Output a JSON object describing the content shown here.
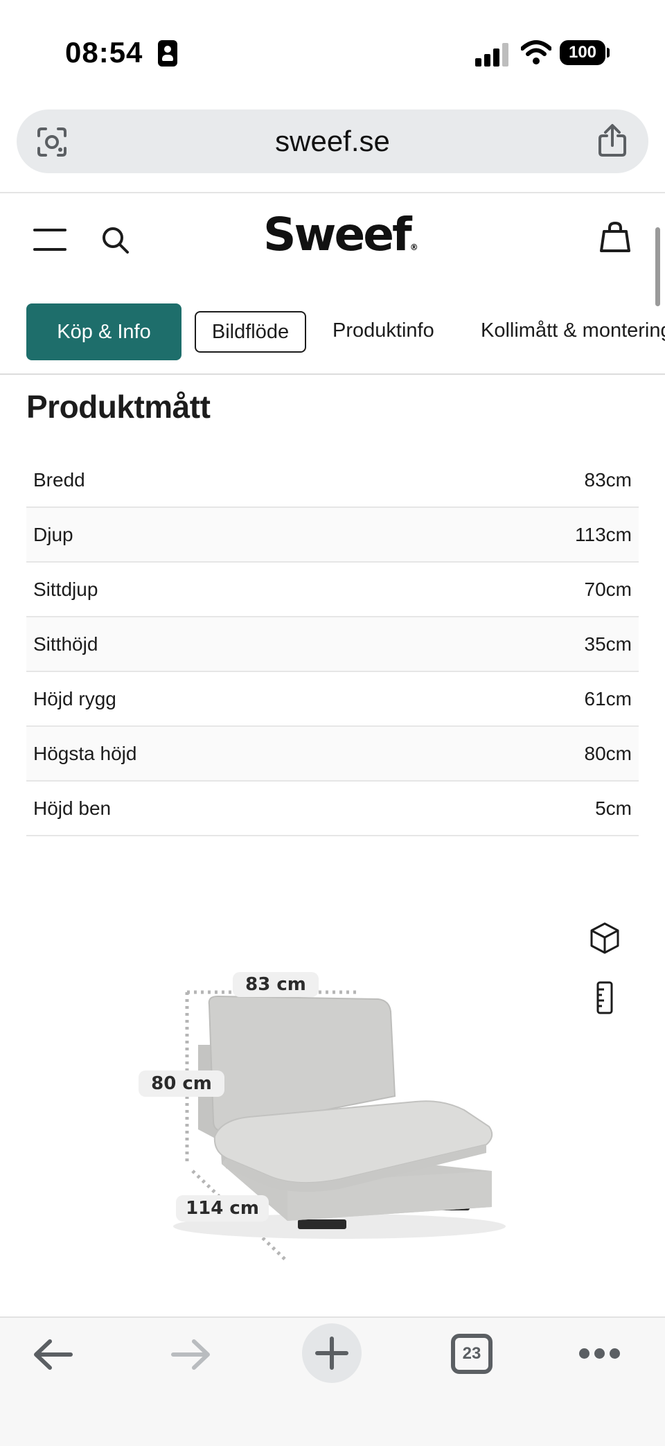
{
  "status_bar": {
    "time": "08:54",
    "battery": "100"
  },
  "browser": {
    "url": "sweef.se",
    "tabs_count": "23"
  },
  "site": {
    "logo": "Sweef",
    "logo_mark": "®"
  },
  "tabs": [
    {
      "label": "Köp & Info",
      "state": "active"
    },
    {
      "label": "Bildflöde",
      "state": "outlined"
    },
    {
      "label": "Produktinfo",
      "state": "normal"
    },
    {
      "label": "Kollimått & montering",
      "state": "normal"
    }
  ],
  "section": {
    "title": "Produktmått"
  },
  "measurements": [
    {
      "label": "Bredd",
      "value": "83cm"
    },
    {
      "label": "Djup",
      "value": "113cm"
    },
    {
      "label": "Sittdjup",
      "value": "70cm"
    },
    {
      "label": "Sitthöjd",
      "value": "35cm"
    },
    {
      "label": "Höjd rygg",
      "value": "61cm"
    },
    {
      "label": "Högsta höjd",
      "value": "80cm"
    },
    {
      "label": "Höjd ben",
      "value": "5cm"
    }
  ],
  "illustration": {
    "width_label": "83 cm",
    "height_label": "80 cm",
    "depth_label": "114 cm"
  },
  "colors": {
    "accent": "#1e6e6b",
    "sofa": "#d3d3d1"
  },
  "icons": {
    "url_left": "lens-icon",
    "url_right": "share-icon",
    "header_left": [
      "menu-icon",
      "search-icon"
    ],
    "header_right": "bag-icon",
    "view_tools": [
      "cube-3d-icon",
      "ruler-icon"
    ],
    "bottom": [
      "back-icon",
      "forward-icon",
      "plus-icon",
      "tabs-icon",
      "more-icon"
    ]
  }
}
